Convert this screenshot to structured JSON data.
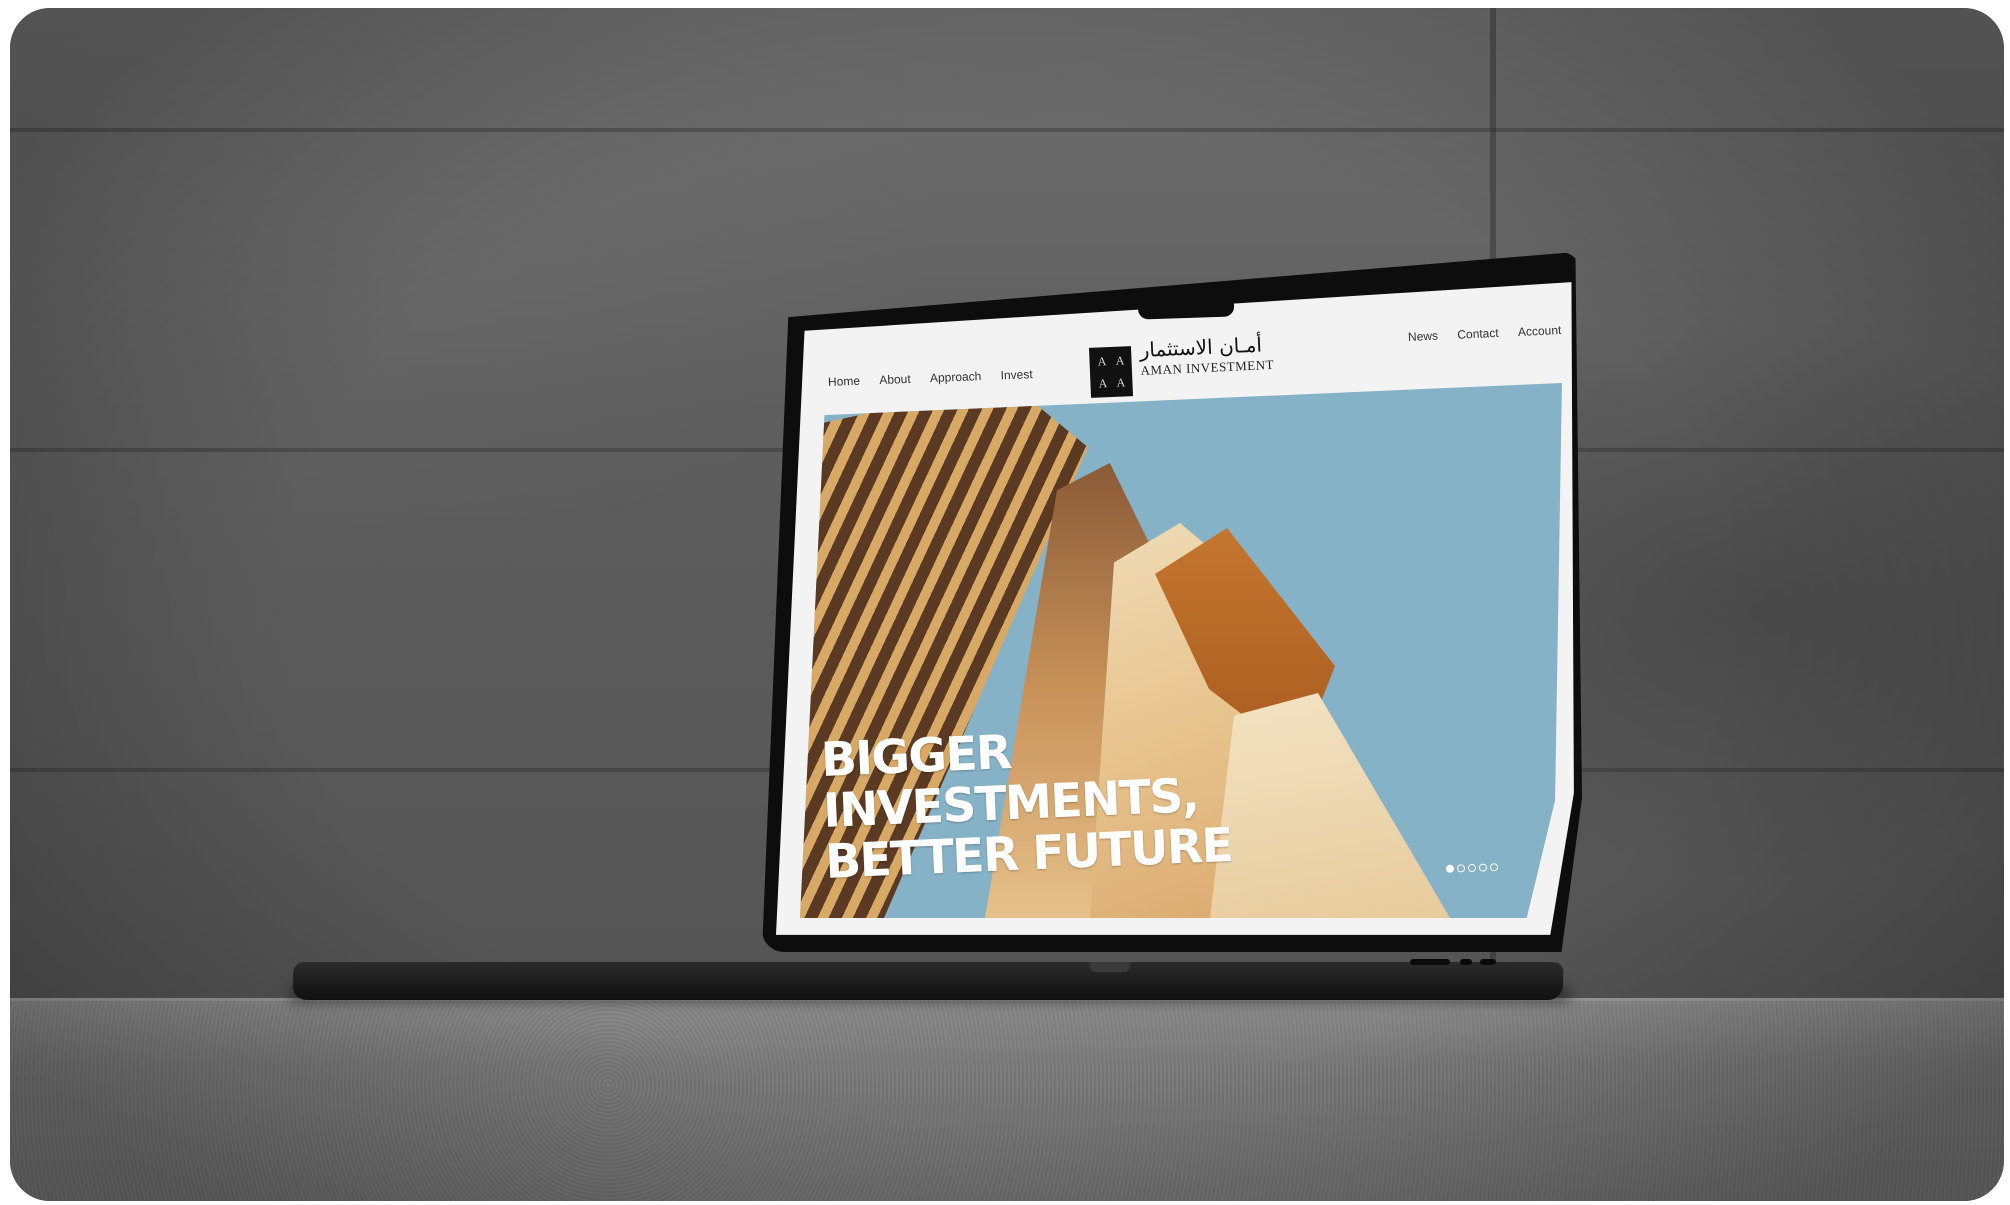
{
  "site": {
    "nav_left": [
      "Home",
      "About",
      "Approach",
      "Invest"
    ],
    "nav_right": [
      "News",
      "Contact",
      "Account"
    ],
    "logo": {
      "monogram": [
        "A",
        "A",
        "A",
        "A"
      ],
      "arabic_name": "أمـان الاستثمار",
      "english_name": "AMAN INVESTMENT"
    },
    "hero": {
      "headline": "BIGGER\nINVESTMENTS,\nBETTER FUTURE"
    },
    "carousel": {
      "total_slides": 5,
      "active_index": 0
    }
  },
  "colors": {
    "sky": "#86b2c7",
    "screen_bg": "#f3f3f3",
    "laptop": "#111111",
    "wall": "#5e5e5e"
  }
}
